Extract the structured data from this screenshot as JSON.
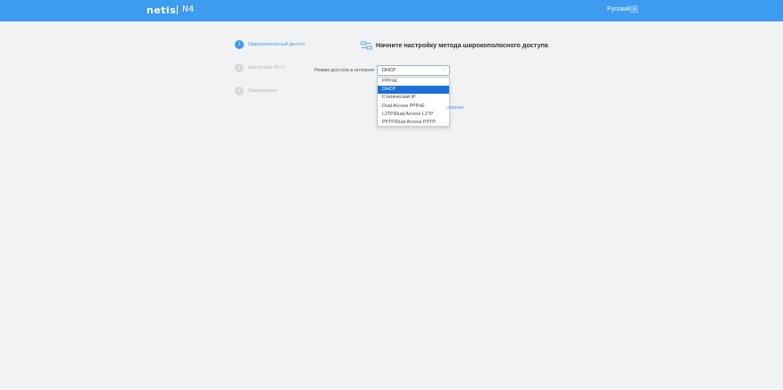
{
  "header": {
    "brand": "netis",
    "model": "N4",
    "language": "Русский",
    "language_toggle": "⌄"
  },
  "steps": [
    {
      "num": "1",
      "label": "Широкополосный доступ",
      "active": true
    },
    {
      "num": "2",
      "label": "Настройка Wi-Fi",
      "active": false
    },
    {
      "num": "3",
      "label": "Завершение",
      "active": false
    }
  ],
  "main": {
    "title": "Начните настройку метода широкополосного доступа",
    "access_mode_label": "Режим доступа в интернет",
    "access_mode_value": "DHCP",
    "options": [
      "PPPoE",
      "DHCP",
      "Статический IP",
      "Dual Access PPPoE",
      "L2TP/Dual Access L2TP",
      "PPTP/Dual Access PPTP"
    ],
    "selected_index": 1,
    "partial_link": "нтернет"
  },
  "colors": {
    "accent": "#3d9bf0",
    "selected_option": "#1f6fd8",
    "background": "#f1f2f4"
  }
}
